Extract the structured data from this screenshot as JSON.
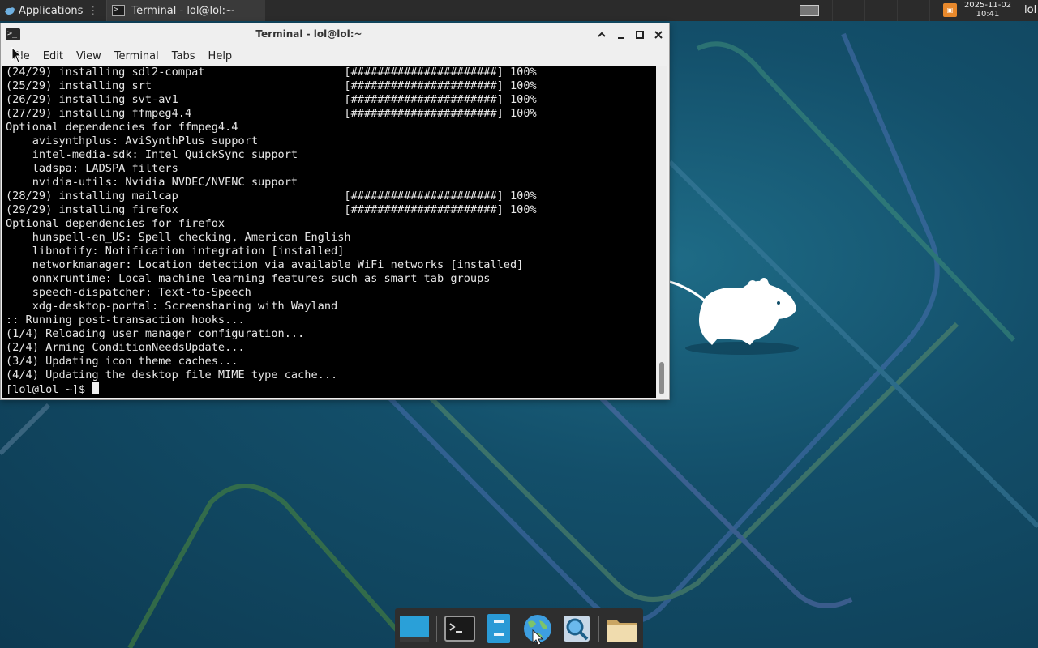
{
  "panel": {
    "applications_label": "Applications",
    "task_title": "Terminal - lol@lol:~",
    "clock_date": "2025-11-02",
    "clock_time": "10:41",
    "user": "lol"
  },
  "window": {
    "title": "Terminal - lol@lol:~",
    "menu": [
      "File",
      "Edit",
      "View",
      "Terminal",
      "Tabs",
      "Help"
    ]
  },
  "terminal": {
    "lines": [
      "(24/29) installing sdl2-compat                     [######################] 100%",
      "(25/29) installing srt                             [######################] 100%",
      "(26/29) installing svt-av1                         [######################] 100%",
      "(27/29) installing ffmpeg4.4                       [######################] 100%",
      "Optional dependencies for ffmpeg4.4",
      "    avisynthplus: AviSynthPlus support",
      "    intel-media-sdk: Intel QuickSync support",
      "    ladspa: LADSPA filters",
      "    nvidia-utils: Nvidia NVDEC/NVENC support",
      "(28/29) installing mailcap                         [######################] 100%",
      "(29/29) installing firefox                         [######################] 100%",
      "Optional dependencies for firefox",
      "    hunspell-en_US: Spell checking, American English",
      "    libnotify: Notification integration [installed]",
      "    networkmanager: Location detection via available WiFi networks [installed]",
      "    onnxruntime: Local machine learning features such as smart tab groups",
      "    speech-dispatcher: Text-to-Speech",
      "    xdg-desktop-portal: Screensharing with Wayland",
      ":: Running post-transaction hooks...",
      "(1/4) Reloading user manager configuration...",
      "(2/4) Arming ConditionNeedsUpdate...",
      "(3/4) Updating icon theme caches...",
      "(4/4) Updating the desktop file MIME type cache..."
    ],
    "prompt": "[lol@lol ~]$ "
  },
  "colors": {
    "desktop_bg": "#134f6a",
    "panel_bg": "#2b2b2b",
    "terminal_bg": "#000000",
    "terminal_fg": "#e6e6e6",
    "tray_accent": "#e8892c"
  },
  "icons": {
    "apps_menu": "xfce-mouse-icon",
    "task": "terminal-icon",
    "dock": [
      "desktop-icon",
      "terminal-icon",
      "file-manager-icon",
      "web-browser-icon",
      "app-finder-icon",
      "folder-icon"
    ]
  }
}
